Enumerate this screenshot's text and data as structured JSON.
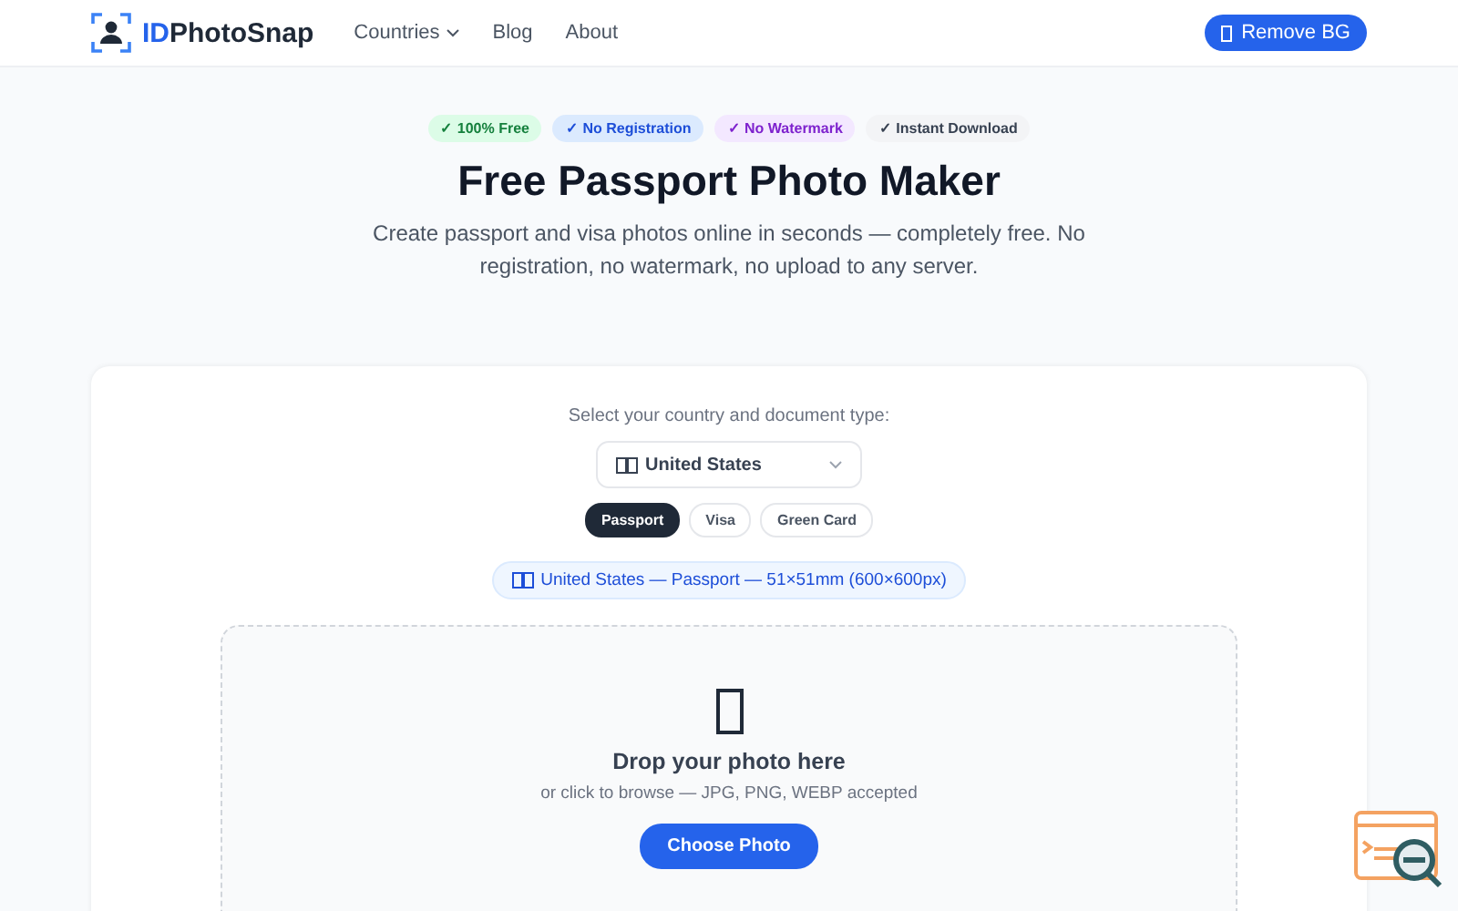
{
  "header": {
    "logo": {
      "prefix": "ID",
      "name": "PhotoSnap"
    },
    "nav": [
      {
        "label": "Countries",
        "kind": "dropdown"
      },
      {
        "label": "Blog",
        "kind": "link"
      },
      {
        "label": "About",
        "kind": "link"
      }
    ],
    "action": "Remove BG"
  },
  "badges": [
    {
      "label": "✓ 100% Free",
      "color": "#dcfce7"
    },
    {
      "label": "✓ No Registration",
      "color": "#dbeafe"
    },
    {
      "label": "✓ No Watermark",
      "color": "#f3e8ff"
    },
    {
      "label": "✓ Instant Download",
      "color": "#f3f4f6"
    }
  ],
  "title": "Free Passport Photo Maker",
  "subtitle": "Create passport and visa photos online in seconds — completely free. No registration, no watermark, no upload to any server.",
  "card": {
    "prompt": "Select your country and document type:",
    "country": "United States",
    "doc_types": [
      {
        "label": "Passport",
        "selected": true
      },
      {
        "label": "Visa",
        "selected": false
      },
      {
        "label": "Green Card",
        "selected": false
      }
    ],
    "spec": "United States — Passport — 51×51mm (600×600px)",
    "dropzone": {
      "title": "Drop your photo here",
      "hint": "or click to browse — JPG, PNG, WEBP accepted",
      "button": "Choose Photo"
    }
  }
}
